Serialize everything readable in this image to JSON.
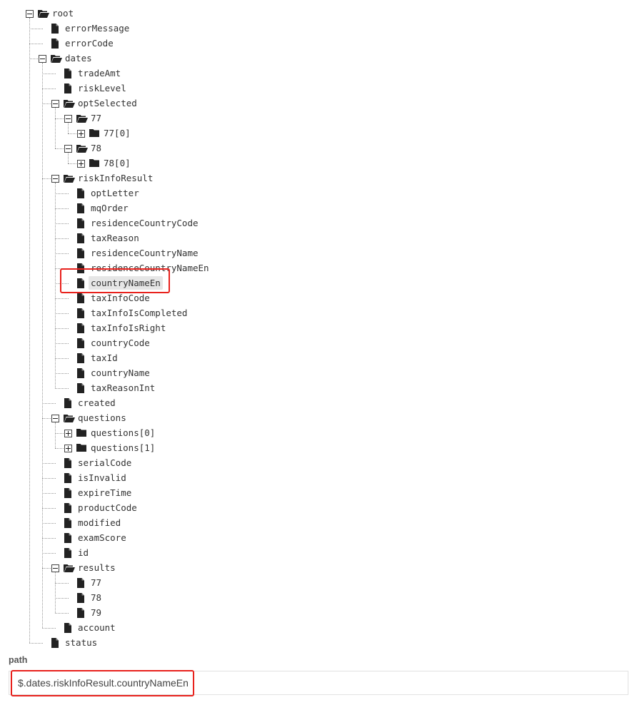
{
  "tree": {
    "name": "root",
    "open": true,
    "children": [
      {
        "name": "errorMessage"
      },
      {
        "name": "errorCode"
      },
      {
        "name": "dates",
        "open": true,
        "children": [
          {
            "name": "tradeAmt"
          },
          {
            "name": "riskLevel"
          },
          {
            "name": "optSelected",
            "open": true,
            "children": [
              {
                "name": "77",
                "open": true,
                "children": [
                  {
                    "name": "77[0]",
                    "collapsed": true
                  }
                ]
              },
              {
                "name": "78",
                "open": true,
                "children": [
                  {
                    "name": "78[0]",
                    "collapsed": true
                  }
                ]
              }
            ]
          },
          {
            "name": "riskInfoResult",
            "open": true,
            "children": [
              {
                "name": "optLetter"
              },
              {
                "name": "mqOrder"
              },
              {
                "name": "residenceCountryCode"
              },
              {
                "name": "taxReason"
              },
              {
                "name": "residenceCountryName"
              },
              {
                "name": "residenceCountryNameEn"
              },
              {
                "name": "countryNameEn",
                "selected": true,
                "highlighted": true
              },
              {
                "name": "taxInfoCode"
              },
              {
                "name": "taxInfoIsCompleted"
              },
              {
                "name": "taxInfoIsRight"
              },
              {
                "name": "countryCode"
              },
              {
                "name": "taxId"
              },
              {
                "name": "countryName"
              },
              {
                "name": "taxReasonInt"
              }
            ]
          },
          {
            "name": "created"
          },
          {
            "name": "questions",
            "open": true,
            "children": [
              {
                "name": "questions[0]",
                "collapsed": true
              },
              {
                "name": "questions[1]",
                "collapsed": true
              }
            ]
          },
          {
            "name": "serialCode"
          },
          {
            "name": "isInvalid"
          },
          {
            "name": "expireTime"
          },
          {
            "name": "productCode"
          },
          {
            "name": "modified"
          },
          {
            "name": "examScore"
          },
          {
            "name": "id"
          },
          {
            "name": "results",
            "open": true,
            "children": [
              {
                "name": "77"
              },
              {
                "name": "78"
              },
              {
                "name": "79"
              }
            ]
          },
          {
            "name": "account"
          }
        ]
      },
      {
        "name": "status"
      }
    ]
  },
  "path_panel": {
    "title": "path",
    "value": "$.dates.riskInfoResult.countryNameEn"
  },
  "colors": {
    "highlight": "#e8211c",
    "selected_bg": "#e6e6e6",
    "icon": "#222222"
  }
}
